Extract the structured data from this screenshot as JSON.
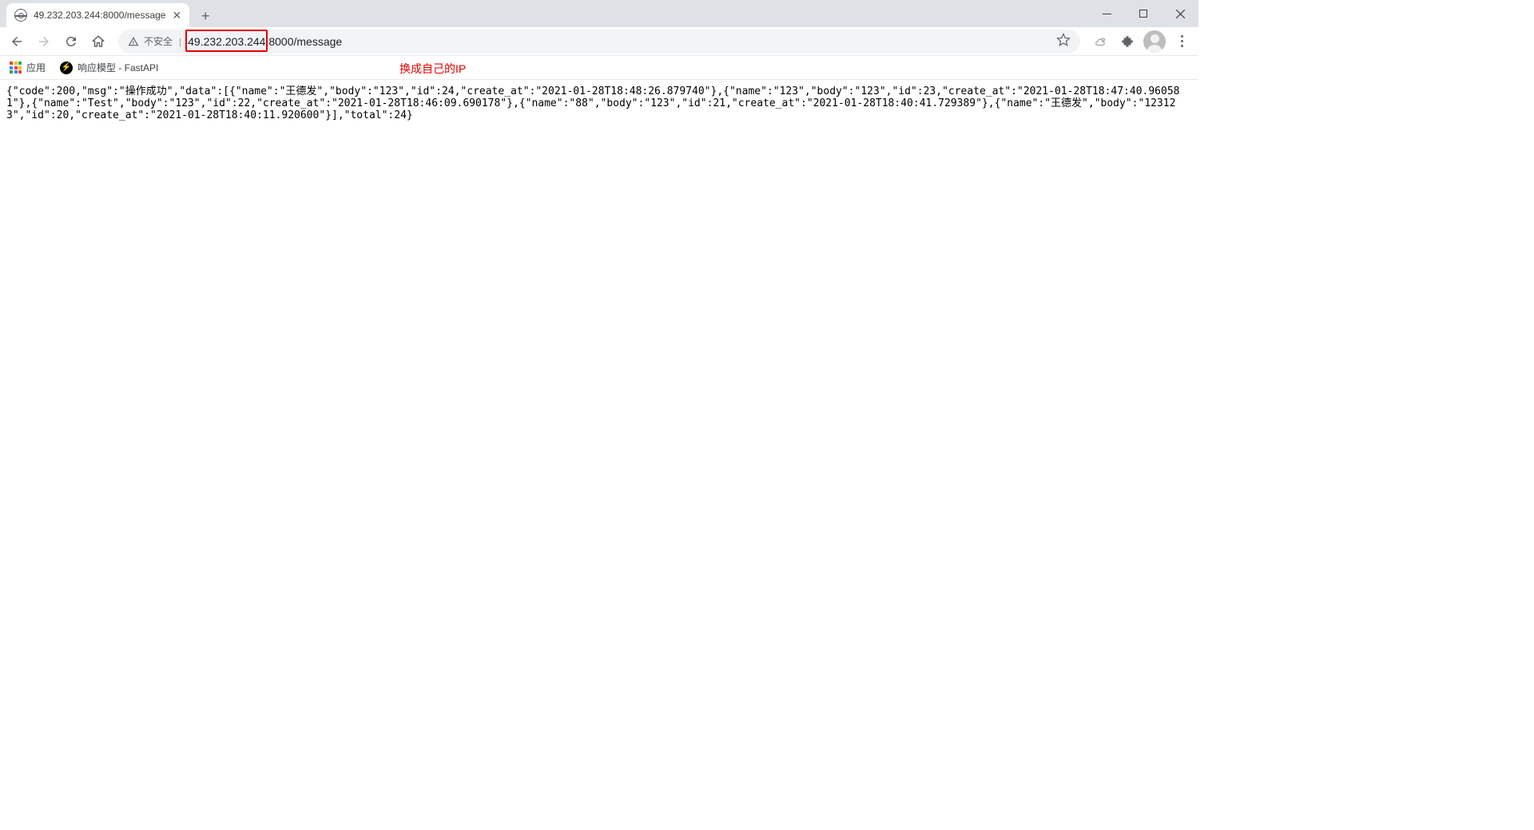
{
  "tab": {
    "title": "49.232.203.244:8000/message"
  },
  "toolbar": {
    "security_label": "不安全",
    "url_prefix": "49.232.203.244",
    "url_suffix": ":8000/message"
  },
  "bookmarks": {
    "apps_label": "应用",
    "item1_label": "响应模型 - FastAPI"
  },
  "annotation": "换成自己的IP",
  "page_body": "{\"code\":200,\"msg\":\"操作成功\",\"data\":[{\"name\":\"王德发\",\"body\":\"123\",\"id\":24,\"create_at\":\"2021-01-28T18:48:26.879740\"},{\"name\":\"123\",\"body\":\"123\",\"id\":23,\"create_at\":\"2021-01-28T18:47:40.960581\"},{\"name\":\"Test\",\"body\":\"123\",\"id\":22,\"create_at\":\"2021-01-28T18:46:09.690178\"},{\"name\":\"88\",\"body\":\"123\",\"id\":21,\"create_at\":\"2021-01-28T18:40:41.729389\"},{\"name\":\"王德发\",\"body\":\"123123\",\"id\":20,\"create_at\":\"2021-01-28T18:40:11.920600\"}],\"total\":24}"
}
